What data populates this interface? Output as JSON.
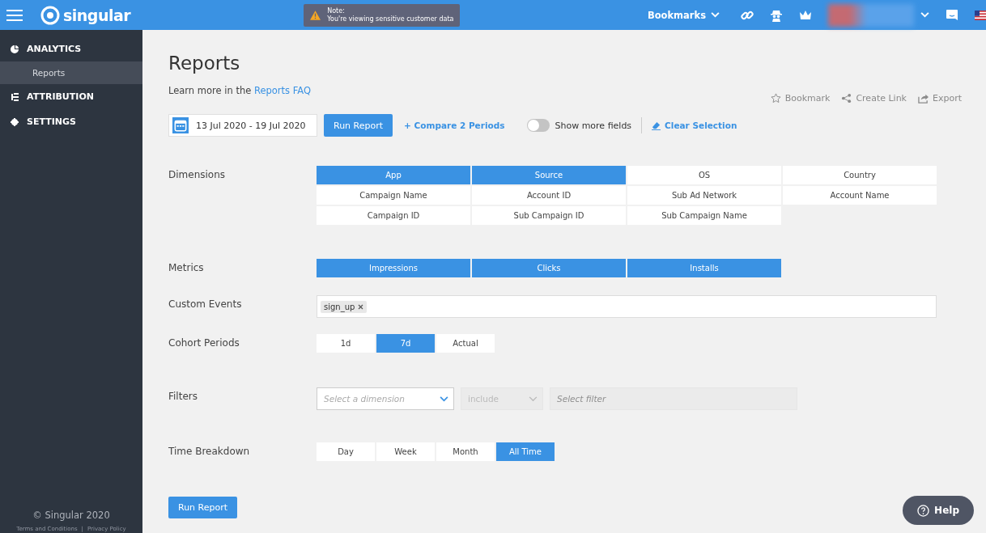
{
  "topbar": {
    "logo": "singular",
    "note": {
      "title": "Note:",
      "text": "You're viewing sensitive customer data"
    },
    "bookmarks": "Bookmarks"
  },
  "sidebar": {
    "items": [
      {
        "label": "ANALYTICS",
        "kind": "analytics",
        "children": [
          {
            "label": "Reports",
            "selected": true
          }
        ]
      },
      {
        "label": "ATTRIBUTION",
        "kind": "attribution"
      },
      {
        "label": "SETTINGS",
        "kind": "settings"
      }
    ],
    "copyright": "© Singular 2020",
    "links": [
      "Terms and Conditions",
      "|",
      "Privacy Policy"
    ]
  },
  "page": {
    "title": "Reports",
    "faq_prefix": "Learn more in the",
    "faq_link": "Reports FAQ",
    "actions": [
      {
        "label": "Bookmark",
        "kind": "star",
        "disabled": true
      },
      {
        "label": "Create Link",
        "kind": "share",
        "disabled": true
      },
      {
        "label": "Export",
        "kind": "export",
        "disabled": true
      }
    ],
    "date_range": "13 Jul 2020 - 19 Jul 2020",
    "run_button": "Run Report",
    "compare": "+ Compare 2 Periods",
    "toggle": {
      "label": "Show more fields",
      "on": false
    },
    "clear": "Clear Selection"
  },
  "sections": [
    {
      "label": "Dimensions",
      "kind": "grid",
      "options": [
        {
          "label": "App",
          "selected": true
        },
        {
          "label": "Source",
          "selected": true
        },
        {
          "label": "OS",
          "selected": false
        },
        {
          "label": "Country",
          "selected": false
        },
        {
          "label": "Campaign Name",
          "selected": false
        },
        {
          "label": "Account ID",
          "selected": false
        },
        {
          "label": "Sub Ad Network",
          "selected": false
        },
        {
          "label": "Account Name",
          "selected": false
        },
        {
          "label": "Campaign ID",
          "selected": false
        },
        {
          "label": "Sub Campaign ID",
          "selected": false
        },
        {
          "label": "Sub Campaign Name",
          "selected": false
        }
      ]
    },
    {
      "label": "Metrics",
      "kind": "grid",
      "options": [
        {
          "label": "Impressions",
          "selected": true
        },
        {
          "label": "Clicks",
          "selected": true
        },
        {
          "label": "Installs",
          "selected": true
        }
      ]
    },
    {
      "label": "Custom Events",
      "kind": "tags",
      "tags": [
        "sign_up"
      ]
    },
    {
      "label": "Cohort Periods",
      "kind": "segments",
      "options": [
        {
          "label": "1d",
          "selected": false
        },
        {
          "label": "7d",
          "selected": true
        },
        {
          "label": "Actual",
          "selected": false
        }
      ]
    },
    {
      "label": "Filters",
      "kind": "filters",
      "dimension": {
        "placeholder": "Select a dimension"
      },
      "operator": {
        "value": "include",
        "disabled": true
      },
      "filter": {
        "placeholder": "Select filter",
        "disabled": true
      }
    },
    {
      "label": "Time Breakdown",
      "kind": "segments",
      "options": [
        {
          "label": "Day",
          "selected": false
        },
        {
          "label": "Week",
          "selected": false
        },
        {
          "label": "Month",
          "selected": false
        },
        {
          "label": "All Time",
          "selected": true
        }
      ]
    }
  ],
  "bottom_button": "Run Report",
  "help": "Help"
}
